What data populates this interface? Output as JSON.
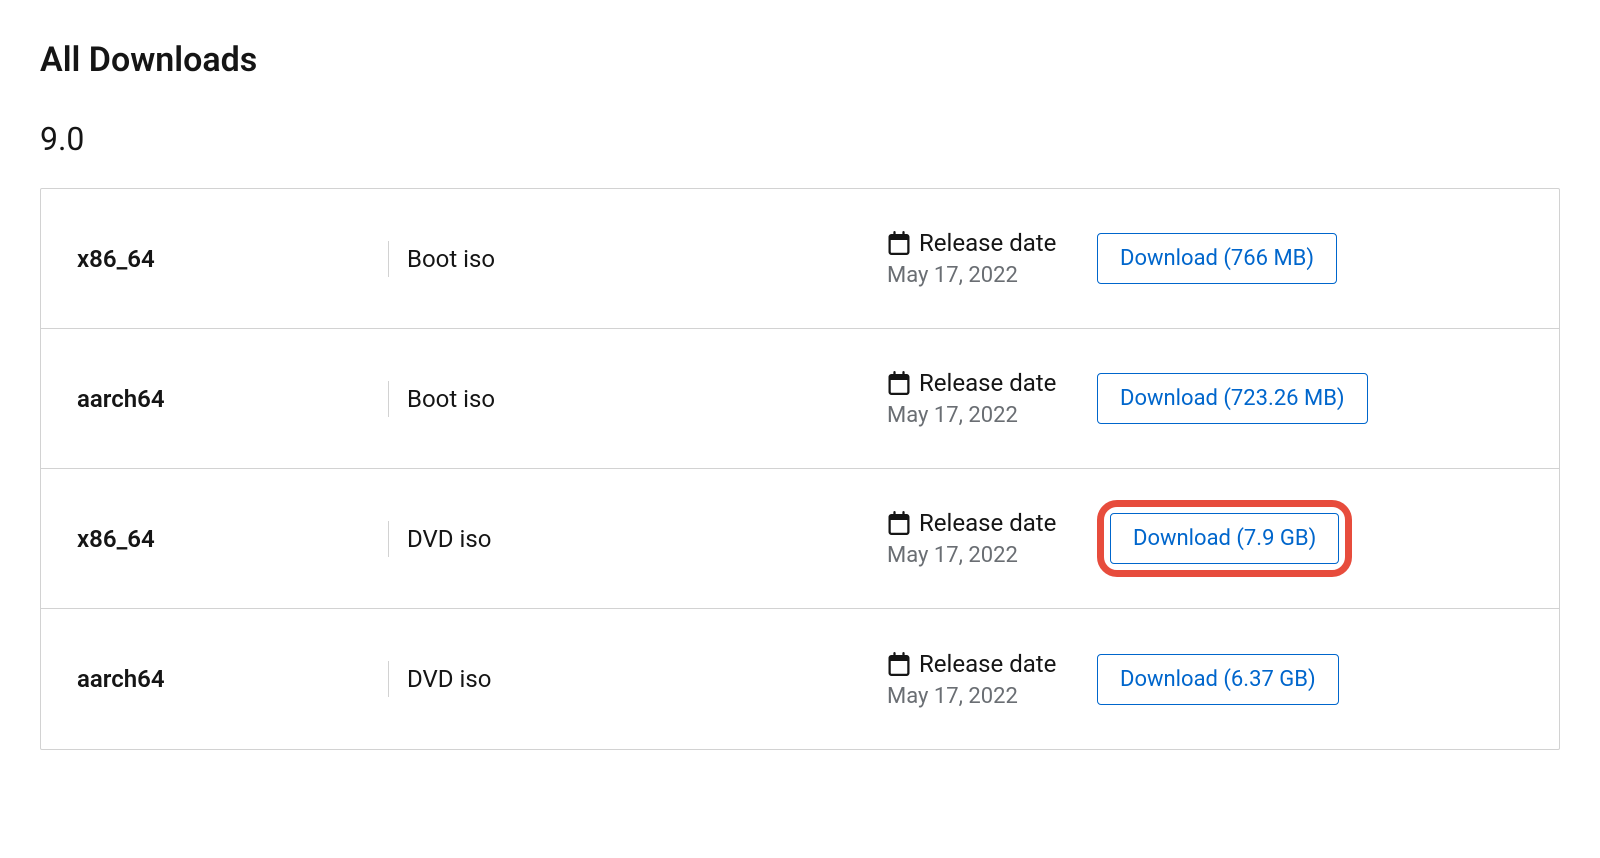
{
  "page_title": "All Downloads",
  "version": "9.0",
  "release_label": "Release date",
  "downloads": [
    {
      "arch": "x86_64",
      "type": "Boot iso",
      "release_date": "May 17, 2022",
      "button_label": "Download (766 MB)",
      "highlighted": false
    },
    {
      "arch": "aarch64",
      "type": "Boot iso",
      "release_date": "May 17, 2022",
      "button_label": "Download (723.26 MB)",
      "highlighted": false
    },
    {
      "arch": "x86_64",
      "type": "DVD iso",
      "release_date": "May 17, 2022",
      "button_label": "Download (7.9 GB)",
      "highlighted": true
    },
    {
      "arch": "aarch64",
      "type": "DVD iso",
      "release_date": "May 17, 2022",
      "button_label": "Download (6.37 GB)",
      "highlighted": false
    }
  ]
}
